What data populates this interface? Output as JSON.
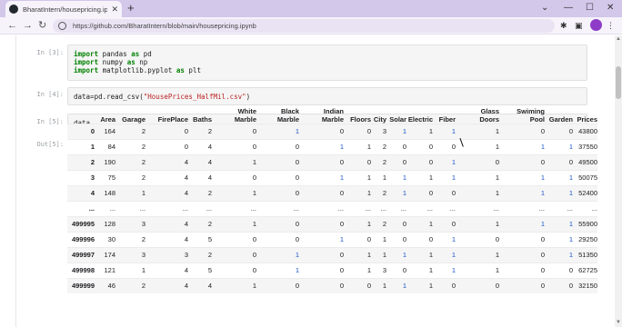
{
  "browser": {
    "tab_title": "BharatIntern/housepricing.ipynb",
    "tab_close": "✕",
    "new_tab": "+",
    "url": "https://github.com/BharatIntern/blob/main/housepricing.ipynb",
    "back": "←",
    "forward": "→",
    "reload": "↻",
    "min": "—",
    "max": "☐",
    "close": "✕",
    "chevron": "⌄"
  },
  "notebook": {
    "cell_imports": {
      "prompt": "In [3]:",
      "lines": [
        {
          "kw": "import",
          "rest": " pandas ",
          "kw2": "as",
          "alias": " pd"
        },
        {
          "kw": "import",
          "rest": " numpy ",
          "kw2": "as",
          "alias": " np"
        },
        {
          "kw": "import",
          "rest": " matplotlib.pyplot ",
          "kw2": "as",
          "alias": " plt"
        }
      ]
    },
    "cell_read": {
      "prompt": "In [4]:",
      "code_prefix": "data=pd.read_csv(",
      "code_string": "\"HousePrices_HalfMil.csv\"",
      "code_suffix": ")"
    },
    "cell_data": {
      "prompt": "In [5]:",
      "code": "data",
      "out_prompt": "Out[5]:"
    },
    "dataframe": {
      "columns": [
        "Area",
        "Garage",
        "FirePlace",
        "Baths",
        "White\nMarble",
        "Black\nMarble",
        "Indian\nMarble",
        "Floors",
        "City",
        "Solar",
        "Electric",
        "Fiber",
        "Glass\nDoors",
        "Swiming\nPool",
        "Garden",
        "Prices"
      ],
      "rows": [
        {
          "index": "0",
          "values": [
            "164",
            "2",
            "0",
            "2",
            "0",
            "1",
            "0",
            "0",
            "3",
            "1",
            "1",
            "1",
            "1",
            "0",
            "0",
            "43800"
          ]
        },
        {
          "index": "1",
          "values": [
            "84",
            "2",
            "0",
            "4",
            "0",
            "0",
            "1",
            "1",
            "2",
            "0",
            "0",
            "0",
            "1",
            "1",
            "1",
            "37550"
          ]
        },
        {
          "index": "2",
          "values": [
            "190",
            "2",
            "4",
            "4",
            "1",
            "0",
            "0",
            "0",
            "2",
            "0",
            "0",
            "1",
            "0",
            "0",
            "0",
            "49500"
          ]
        },
        {
          "index": "3",
          "values": [
            "75",
            "2",
            "4",
            "4",
            "0",
            "0",
            "1",
            "1",
            "1",
            "1",
            "1",
            "1",
            "1",
            "1",
            "1",
            "50075"
          ]
        },
        {
          "index": "4",
          "values": [
            "148",
            "1",
            "4",
            "2",
            "1",
            "0",
            "0",
            "1",
            "2",
            "1",
            "0",
            "0",
            "1",
            "1",
            "1",
            "52400"
          ]
        },
        {
          "index": "...",
          "values": [
            "...",
            "...",
            "...",
            "...",
            "...",
            "...",
            "...",
            "...",
            "...",
            "...",
            "...",
            "...",
            "...",
            "...",
            "...",
            "..."
          ]
        },
        {
          "index": "499995",
          "values": [
            "128",
            "3",
            "4",
            "2",
            "1",
            "0",
            "0",
            "1",
            "2",
            "0",
            "1",
            "0",
            "1",
            "1",
            "1",
            "55900"
          ]
        },
        {
          "index": "499996",
          "values": [
            "30",
            "2",
            "4",
            "5",
            "0",
            "0",
            "1",
            "0",
            "1",
            "0",
            "0",
            "1",
            "0",
            "0",
            "1",
            "29250"
          ]
        },
        {
          "index": "499997",
          "values": [
            "174",
            "3",
            "3",
            "2",
            "0",
            "1",
            "0",
            "1",
            "1",
            "1",
            "1",
            "1",
            "1",
            "0",
            "1",
            "51350"
          ]
        },
        {
          "index": "499998",
          "values": [
            "121",
            "1",
            "4",
            "5",
            "0",
            "1",
            "0",
            "1",
            "3",
            "0",
            "1",
            "1",
            "1",
            "0",
            "0",
            "62725"
          ]
        },
        {
          "index": "499999",
          "values": [
            "46",
            "2",
            "4",
            "4",
            "1",
            "0",
            "0",
            "0",
            "1",
            "1",
            "1",
            "0",
            "0",
            "0",
            "0",
            "32150"
          ]
        }
      ]
    }
  },
  "colors": {
    "link_blue": "#1a54c9",
    "tab_bar": "#d3c7ea",
    "string_red": "#ba2121",
    "keyword_green": "#008000"
  }
}
